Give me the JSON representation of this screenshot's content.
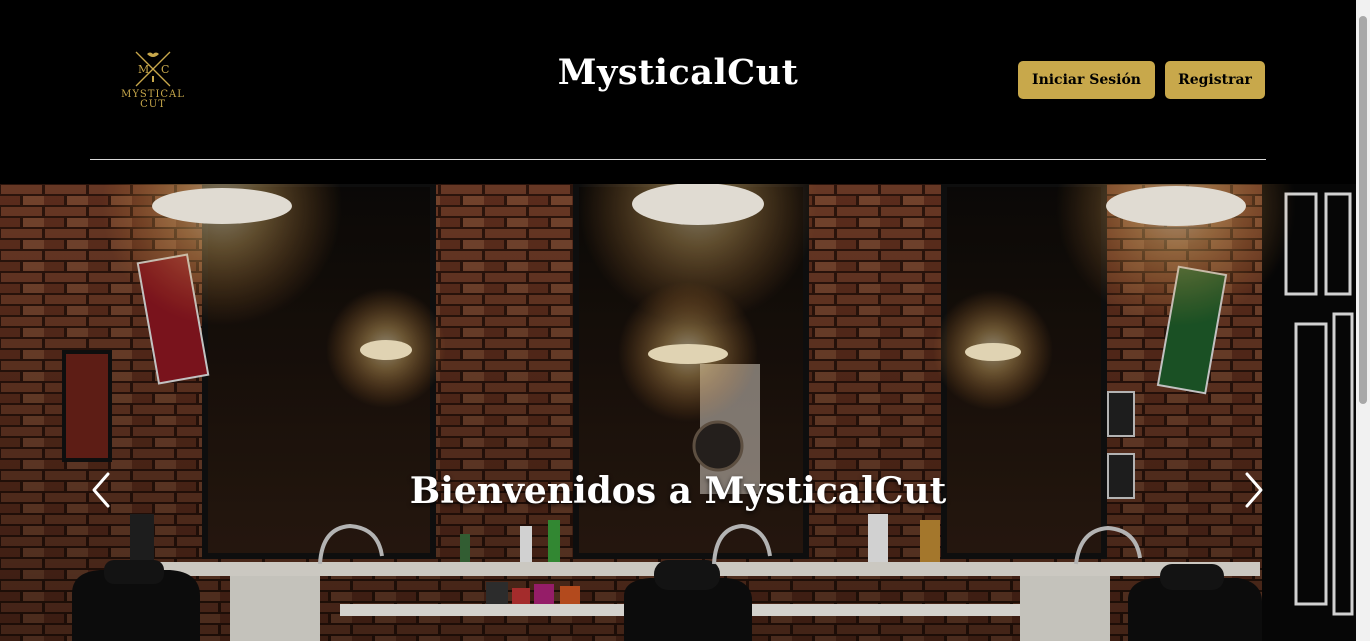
{
  "header": {
    "logo": {
      "icon": "crossed-razors-logo-icon",
      "letters_left": "M",
      "letters_right": "C",
      "line1": "MYSTICAL",
      "line2": "CUT"
    },
    "site_title": "MysticalCut",
    "login_label": "Iniciar Sesión",
    "register_label": "Registrar"
  },
  "hero": {
    "caption": "Bienvenidos a MysticalCut",
    "prev_icon": "chevron-left-icon",
    "next_icon": "chevron-right-icon",
    "image": "barbershop-interior-image"
  },
  "colors": {
    "accent": "#c8a84b",
    "background": "#000000",
    "text": "#ffffff"
  }
}
